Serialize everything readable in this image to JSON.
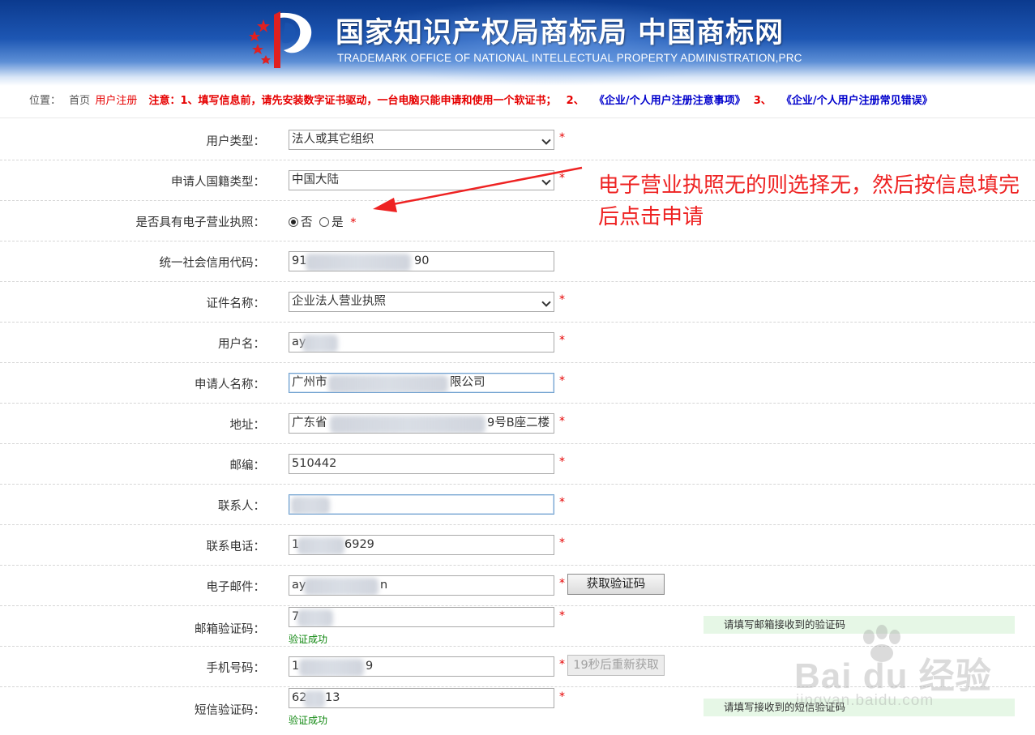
{
  "header": {
    "title": "国家知识产权局商标局 中国商标网",
    "subtitle": "TRADEMARK OFFICE OF NATIONAL INTELLECTUAL PROPERTY ADMINISTRATION,PRC"
  },
  "breadcrumb": {
    "location_label": "位置：",
    "home": "首页",
    "current": "用户注册",
    "notice_1": "注意：1、填写信息前，请先安装数字证书驱动，一台电脑只能申请和使用一个软证书；",
    "notice_2_num": "2、",
    "notice_2_link": "《企业/个人用户注册注意事项》",
    "notice_3_num": "3、",
    "notice_3_link": "《企业/个人用户注册常见错误》"
  },
  "form": {
    "required_mark": "*",
    "user_type": {
      "label": "用户类型：",
      "value": "法人或其它组织"
    },
    "nationality": {
      "label": "申请人国籍类型：",
      "value": "中国大陆"
    },
    "e_license": {
      "label": "是否具有电子营业执照：",
      "option_no": "否",
      "option_yes": "是",
      "selected": "否"
    },
    "credit_code": {
      "label": "统一社会信用代码：",
      "value_start": "91",
      "value_end": "90"
    },
    "cert_name": {
      "label": "证件名称：",
      "value": "企业法人营业执照"
    },
    "username": {
      "label": "用户名：",
      "value_start": "ay"
    },
    "applicant_name": {
      "label": "申请人名称：",
      "value_start": "广州市",
      "value_end": "限公司"
    },
    "address": {
      "label": "地址：",
      "value_start": "广东省",
      "value_end": "9号B座二楼"
    },
    "postcode": {
      "label": "邮编：",
      "value": "510442"
    },
    "contact": {
      "label": "联系人："
    },
    "phone": {
      "label": "联系电话：",
      "value_start": "1",
      "value_end": "6929"
    },
    "email": {
      "label": "电子邮件：",
      "value_start": "ay",
      "value_end": "n",
      "button": "获取验证码"
    },
    "email_code": {
      "label": "邮箱验证码：",
      "value_start": "7",
      "status": "验证成功",
      "hint": "请填写邮箱接收到的验证码"
    },
    "mobile": {
      "label": "手机号码：",
      "value_start": "1",
      "value_end": "9",
      "button": "19秒后重新获取"
    },
    "sms_code": {
      "label": "短信验证码：",
      "value_start": "62",
      "value_end": "13",
      "status": "验证成功",
      "hint": "请填写接收到的短信验证码"
    }
  },
  "annotation": {
    "text": "电子营业执照无的则选择无，然后按信息填完后点击申请",
    "color": "#ee2222"
  },
  "watermark": {
    "brand": "Bai du 经验",
    "url": "jingyan.baidu.com"
  },
  "colors": {
    "banner": "#1d56b3",
    "required": "#e60000",
    "link": "#0000cc",
    "success": "#118811",
    "hint_bg": "#e6f7e6"
  }
}
